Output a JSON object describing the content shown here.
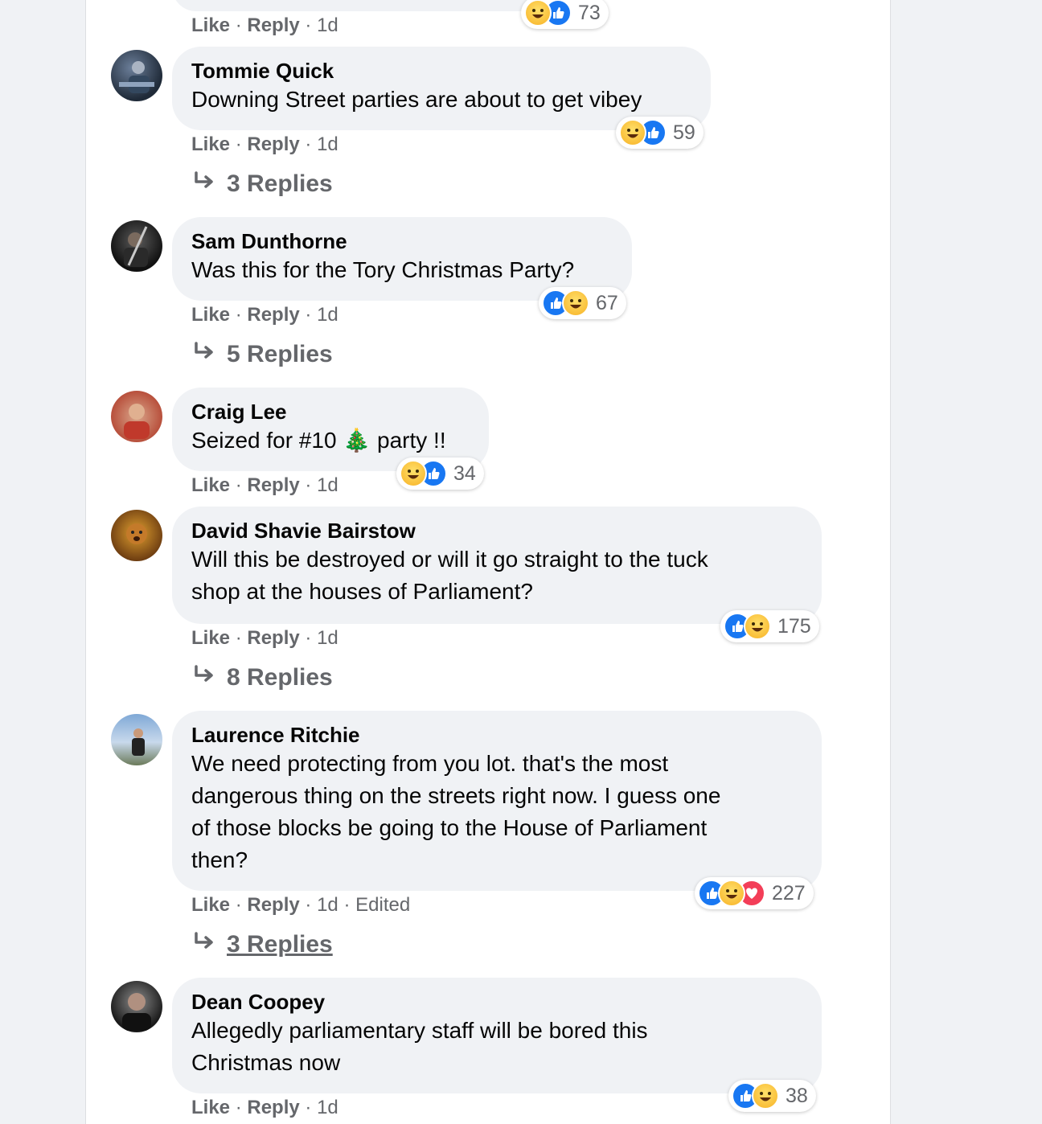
{
  "actions": {
    "like": "Like",
    "reply": "Reply",
    "dot": "·"
  },
  "top_partial": {
    "time": "1d",
    "reaction_count": "73"
  },
  "comments": [
    {
      "name": "Tommie Quick",
      "text": [
        "Downing Street parties are about to get vibey"
      ],
      "time": "1d",
      "reaction_count": "59",
      "replies": "3 Replies"
    },
    {
      "name": "Sam Dunthorne",
      "text": [
        "Was this for the Tory Christmas Party?"
      ],
      "time": "1d",
      "reaction_count": "67",
      "replies": "5 Replies"
    },
    {
      "name": "Craig Lee",
      "text_before": "Seized for #10",
      "emoji": "🎄",
      "text_after": "party !!",
      "time": "1d",
      "reaction_count": "34"
    },
    {
      "name": "David Shavie Bairstow",
      "text": [
        "Will this be destroyed or will it go straight to the tuck",
        "shop at the houses of Parliament?"
      ],
      "time": "1d",
      "reaction_count": "175",
      "replies": "8 Replies"
    },
    {
      "name": "Laurence Ritchie",
      "text": [
        "We need protecting from you lot. that's the most",
        "dangerous thing on the streets right now. I guess one",
        "of those blocks be going to the House of Parliament",
        "then?"
      ],
      "time": "1d",
      "edited": "Edited",
      "reaction_count": "227",
      "replies": "3 Replies"
    },
    {
      "name": "Dean Coopey",
      "text": [
        "Allegedly parliamentary staff will be bored this",
        "Christmas now"
      ],
      "time": "1d",
      "reaction_count": "38"
    }
  ],
  "colors": {
    "like": "#1877f2",
    "haha": "#f7b125",
    "love": "#f33e58",
    "bubble": "#f0f2f5",
    "meta": "#65676b"
  },
  "icons": [
    "like-reaction-icon",
    "haha-reaction-icon",
    "love-reaction-icon",
    "reply-arrow-icon"
  ]
}
